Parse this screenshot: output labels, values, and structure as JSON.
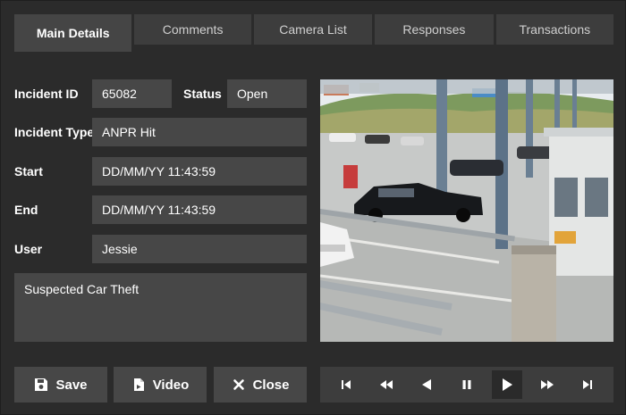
{
  "tabs": [
    {
      "label": "Main Details",
      "active": true
    },
    {
      "label": "Comments",
      "active": false
    },
    {
      "label": "Camera List",
      "active": false
    },
    {
      "label": "Responses",
      "active": false
    },
    {
      "label": "Transactions",
      "active": false
    }
  ],
  "form": {
    "incident_id_label": "Incident ID",
    "incident_id_value": "65082",
    "status_label": "Status",
    "status_value": "Open",
    "incident_type_label": "Incident Type",
    "incident_type_value": "ANPR Hit",
    "start_label": "Start",
    "start_value": "DD/MM/YY 11:43:59",
    "end_label": "End",
    "end_value": "DD/MM/YY 11:43:59",
    "user_label": "User",
    "user_value": "Jessie",
    "notes_value": "Suspected Car Theft"
  },
  "actions": {
    "save_label": "Save",
    "video_label": "Video",
    "close_label": "Close"
  },
  "player": {
    "buttons": [
      "skip-to-start",
      "rewind",
      "step-back",
      "pause",
      "play",
      "fast-forward",
      "skip-to-end"
    ],
    "active": "play"
  },
  "colors": {
    "background": "#2b2b2b",
    "field": "#474747",
    "tab": "#3d3d3d",
    "tab_active": "#454545",
    "text": "#ffffff"
  }
}
